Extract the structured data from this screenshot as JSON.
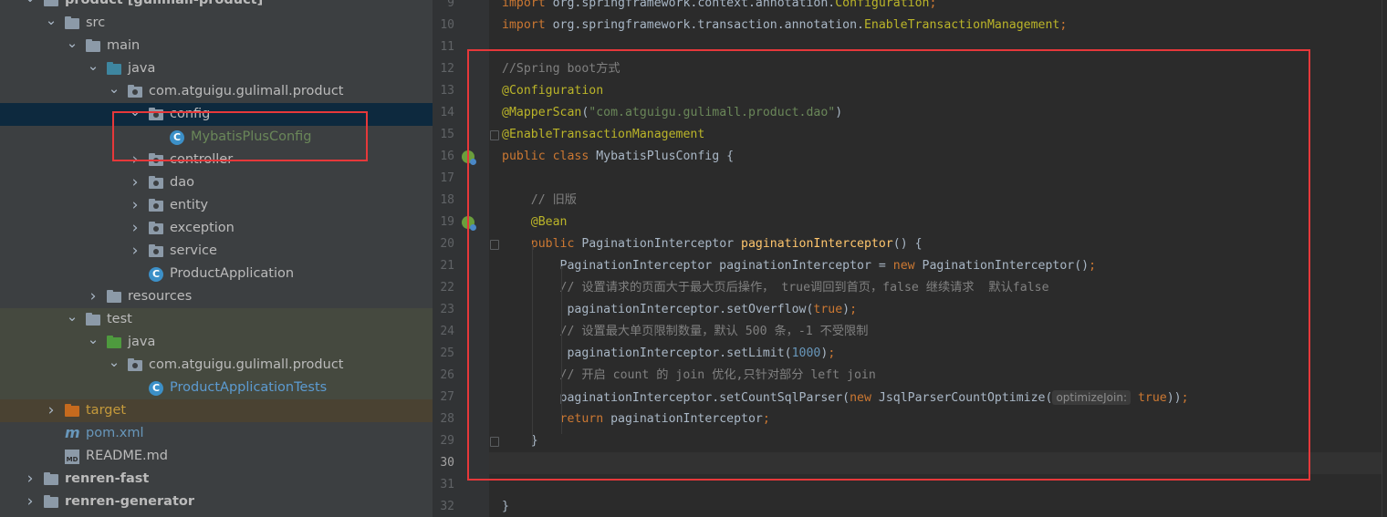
{
  "project_tree": {
    "items": [
      {
        "label": "product [gulimall-product]",
        "depth": 0,
        "kind": "module",
        "arrow": "expanded"
      },
      {
        "label": "src",
        "depth": 1,
        "kind": "folder",
        "arrow": "expanded"
      },
      {
        "label": "main",
        "depth": 2,
        "kind": "folder",
        "arrow": "expanded"
      },
      {
        "label": "java",
        "depth": 3,
        "kind": "source-folder",
        "arrow": "expanded"
      },
      {
        "label": "com.atguigu.gulimall.product",
        "depth": 4,
        "kind": "package",
        "arrow": "expanded"
      },
      {
        "label": "config",
        "depth": 5,
        "kind": "package",
        "arrow": "expanded",
        "selected": true
      },
      {
        "label": "MybatisPlusConfig",
        "depth": 6,
        "kind": "class"
      },
      {
        "label": "controller",
        "depth": 5,
        "kind": "package",
        "arrow": "collapsed"
      },
      {
        "label": "dao",
        "depth": 5,
        "kind": "package",
        "arrow": "collapsed"
      },
      {
        "label": "entity",
        "depth": 5,
        "kind": "package",
        "arrow": "collapsed"
      },
      {
        "label": "exception",
        "depth": 5,
        "kind": "package",
        "arrow": "collapsed"
      },
      {
        "label": "service",
        "depth": 5,
        "kind": "package",
        "arrow": "collapsed"
      },
      {
        "label": "ProductApplication",
        "depth": 5,
        "kind": "app-class"
      },
      {
        "label": "resources",
        "depth": 3,
        "kind": "resources",
        "arrow": "collapsed"
      },
      {
        "label": "test",
        "depth": 2,
        "kind": "folder",
        "arrow": "expanded"
      },
      {
        "label": "java",
        "depth": 3,
        "kind": "test-folder",
        "arrow": "expanded"
      },
      {
        "label": "com.atguigu.gulimall.product",
        "depth": 4,
        "kind": "package",
        "arrow": "expanded"
      },
      {
        "label": "ProductApplicationTests",
        "depth": 5,
        "kind": "test-class"
      },
      {
        "label": "target",
        "depth": 1,
        "kind": "excluded-folder",
        "arrow": "collapsed"
      },
      {
        "label": "pom.xml",
        "depth": 1,
        "kind": "maven"
      },
      {
        "label": "README.md",
        "depth": 1,
        "kind": "markdown"
      },
      {
        "label": "renren-fast",
        "depth": 0,
        "kind": "module",
        "arrow": "collapsed"
      },
      {
        "label": "renren-generator",
        "depth": 0,
        "kind": "module",
        "arrow": "collapsed"
      }
    ]
  },
  "editor": {
    "current_line": "30",
    "lines": [
      {
        "n": "9",
        "tokens": [
          {
            "t": "import ",
            "c": "kw"
          },
          {
            "t": "org.springframework.context.annotation."
          },
          {
            "t": "Configuration",
            "c": "ann"
          },
          {
            "t": ";",
            "c": "kw"
          }
        ]
      },
      {
        "n": "10",
        "tokens": [
          {
            "t": "import ",
            "c": "kw"
          },
          {
            "t": "org.springframework.transaction.annotation."
          },
          {
            "t": "EnableTransactionManagement",
            "c": "ann"
          },
          {
            "t": ";",
            "c": "kw"
          }
        ]
      },
      {
        "n": "11",
        "tokens": []
      },
      {
        "n": "12",
        "tokens": [
          {
            "t": "//Spring boot方式",
            "c": "cmt"
          }
        ]
      },
      {
        "n": "13",
        "tokens": [
          {
            "t": "@Configuration",
            "c": "ann"
          }
        ]
      },
      {
        "n": "14",
        "tokens": [
          {
            "t": "@MapperScan",
            "c": "ann"
          },
          {
            "t": "("
          },
          {
            "t": "\"com.atguigu.gulimall.product.dao\"",
            "c": "str"
          },
          {
            "t": ")"
          }
        ]
      },
      {
        "n": "15",
        "tokens": [
          {
            "t": "@EnableTransactionManagement",
            "c": "ann"
          }
        ]
      },
      {
        "n": "16",
        "tokens": [
          {
            "t": "public class ",
            "c": "kw"
          },
          {
            "t": "MybatisPlusConfig {"
          }
        ]
      },
      {
        "n": "17",
        "tokens": []
      },
      {
        "n": "18",
        "tokens": [
          {
            "t": "    "
          },
          {
            "t": "// 旧版",
            "c": "cmt"
          }
        ]
      },
      {
        "n": "19",
        "tokens": [
          {
            "t": "    "
          },
          {
            "t": "@Bean",
            "c": "ann"
          }
        ]
      },
      {
        "n": "20",
        "tokens": [
          {
            "t": "    "
          },
          {
            "t": "public ",
            "c": "kw"
          },
          {
            "t": "PaginationInterceptor "
          },
          {
            "t": "paginationInterceptor",
            "c": "mth"
          },
          {
            "t": "() {"
          }
        ]
      },
      {
        "n": "21",
        "tokens": [
          {
            "t": "        PaginationInterceptor paginationInterceptor = "
          },
          {
            "t": "new ",
            "c": "kw"
          },
          {
            "t": "PaginationInterceptor()"
          },
          {
            "t": ";",
            "c": "kw"
          }
        ]
      },
      {
        "n": "22",
        "tokens": [
          {
            "t": "        "
          },
          {
            "t": "// 设置请求的页面大于最大页后操作， true调回到首页，false 继续请求  默认false",
            "c": "cmt"
          }
        ]
      },
      {
        "n": "23",
        "tokens": [
          {
            "t": "         paginationInterceptor.setOverflow("
          },
          {
            "t": "true",
            "c": "kw"
          },
          {
            "t": ")"
          },
          {
            "t": ";",
            "c": "kw"
          }
        ]
      },
      {
        "n": "24",
        "tokens": [
          {
            "t": "        "
          },
          {
            "t": "// 设置最大单页限制数量，默认 500 条，-1 不受限制",
            "c": "cmt"
          }
        ]
      },
      {
        "n": "25",
        "tokens": [
          {
            "t": "         paginationInterceptor.setLimit("
          },
          {
            "t": "1000",
            "c": "num"
          },
          {
            "t": ")"
          },
          {
            "t": ";",
            "c": "kw"
          }
        ]
      },
      {
        "n": "26",
        "tokens": [
          {
            "t": "        "
          },
          {
            "t": "// 开启 count 的 join 优化,只针对部分 left join",
            "c": "cmt"
          }
        ]
      },
      {
        "n": "27",
        "tokens": [
          {
            "t": "        paginationInterceptor.setCountSqlParser("
          },
          {
            "t": "new ",
            "c": "kw"
          },
          {
            "t": "JsqlParserCountOptimize("
          },
          {
            "t": "optimizeJoin:",
            "c": "hint"
          },
          {
            "t": " "
          },
          {
            "t": "true",
            "c": "kw"
          },
          {
            "t": "))"
          },
          {
            "t": ";",
            "c": "kw"
          }
        ]
      },
      {
        "n": "28",
        "tokens": [
          {
            "t": "        "
          },
          {
            "t": "return ",
            "c": "kw"
          },
          {
            "t": "paginationInterceptor"
          },
          {
            "t": ";",
            "c": "kw"
          }
        ]
      },
      {
        "n": "29",
        "tokens": [
          {
            "t": "    }"
          }
        ]
      },
      {
        "n": "30",
        "tokens": []
      },
      {
        "n": "31",
        "tokens": []
      },
      {
        "n": "32",
        "tokens": [
          {
            "t": "}"
          }
        ]
      }
    ]
  },
  "colors": {
    "highlight_box": "#e6383a",
    "keyword": "#cc7832",
    "annotation": "#bbb529",
    "string": "#6a8759",
    "number": "#6897bb",
    "comment": "#808080",
    "method": "#ffc66d"
  }
}
